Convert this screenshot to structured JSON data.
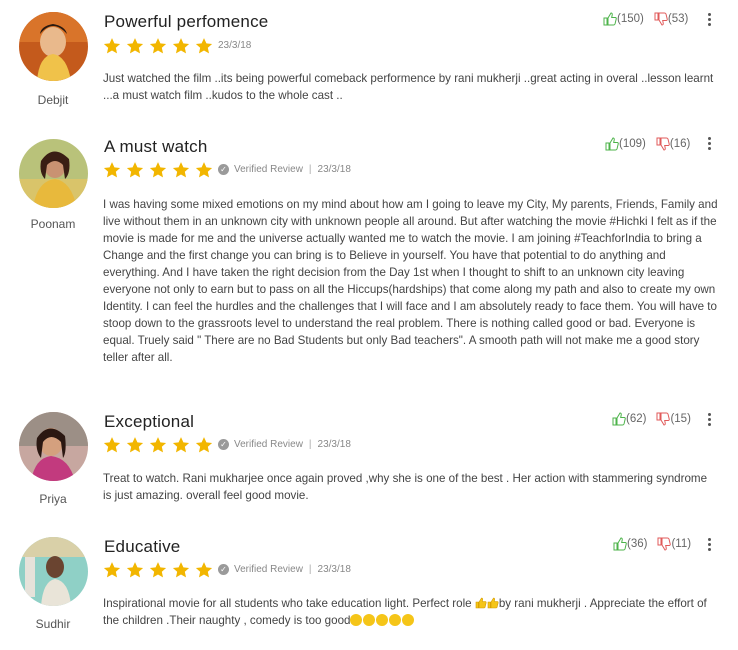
{
  "colors": {
    "star": "#f2b600",
    "up": "#4cb34a",
    "down": "#e05a5a"
  },
  "reviews": [
    {
      "user": "Debjit",
      "title": "Powerful perfomence",
      "verified_label": "",
      "date": "23/3/18",
      "up_count": "(150)",
      "down_count": "(53)",
      "text": "Just watched the film ..its being powerful comeback performence by rani mukherji ..great acting in overal ..lesson learnt ...a must watch film ..kudos to the whole cast ..",
      "rating": 5
    },
    {
      "user": "Poonam",
      "title": "A must watch",
      "verified_label": "Verified Review",
      "date": "23/3/18",
      "up_count": "(109)",
      "down_count": "(16)",
      "text": "I was having some mixed emotions on my mind about how am I going to leave my City, My parents, Friends, Family and live without them in an unknown city with unknown people all around. But after watching the movie #Hichki I felt as if the movie is made for me and the universe actually wanted me to watch the movie. I am joining #TeachforIndia to bring a Change and the first change you can bring is to Believe in yourself. You have that potential to do anything and everything. And I have taken the right decision from the Day 1st when I thought to shift to an unknown city leaving everyone not only to earn but to pass on all the Hiccups(hardships) that come along my path and also to create my own Identity. I can feel the hurdles and the challenges that I will face and I am absolutely ready to face them. You will have to stoop down to the grassroots level to understand the real problem. There is nothing called good or bad. Everyone is equal. Truely said \" There are no Bad Students but only Bad teachers\". A smooth path will not make me a good story teller after all.",
      "rating": 5
    },
    {
      "user": "Priya",
      "title": "Exceptional",
      "verified_label": "Verified Review",
      "date": "23/3/18",
      "up_count": "(62)",
      "down_count": "(15)",
      "text": "Treat to watch. Rani mukharjee once again proved ,why she is one of the best . Her action with stammering syndrome is just amazing. overall feel good movie.",
      "rating": 5
    },
    {
      "user": "Sudhir",
      "title": "Educative",
      "verified_label": "Verified Review",
      "date": "23/3/18",
      "up_count": "(36)",
      "down_count": "(11)",
      "text_a": "Inspirational movie for all students who take education light. Perfect role ",
      "text_b": "by rani mukherji . Appreciate the effort of the children .Their naughty , comedy is too good",
      "rating": 5
    }
  ]
}
